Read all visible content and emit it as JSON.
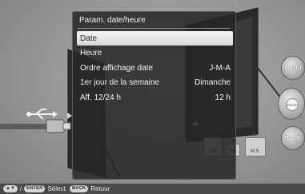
{
  "dialog": {
    "title": "Param. date/heure",
    "items": [
      {
        "label": "Date",
        "value": ""
      },
      {
        "label": "Heure",
        "value": ""
      },
      {
        "label": "Ordre affichage date",
        "value": "J-M-A"
      },
      {
        "label": "1er jour de la semaine",
        "value": "Dimanche"
      },
      {
        "label": "Aff. 12/24 h",
        "value": "12 h"
      }
    ]
  },
  "side_buttons": {
    "menu": "MENU",
    "enter": "ENTER",
    "back": "BACK"
  },
  "slots": {
    "sd": "SD",
    "xd": "XD",
    "ms": "M.S."
  },
  "help_bar": {
    "sep": "/",
    "enter_key": "ENTER",
    "select": "Sélect.",
    "back_key": "BACK",
    "return": "Retour"
  }
}
